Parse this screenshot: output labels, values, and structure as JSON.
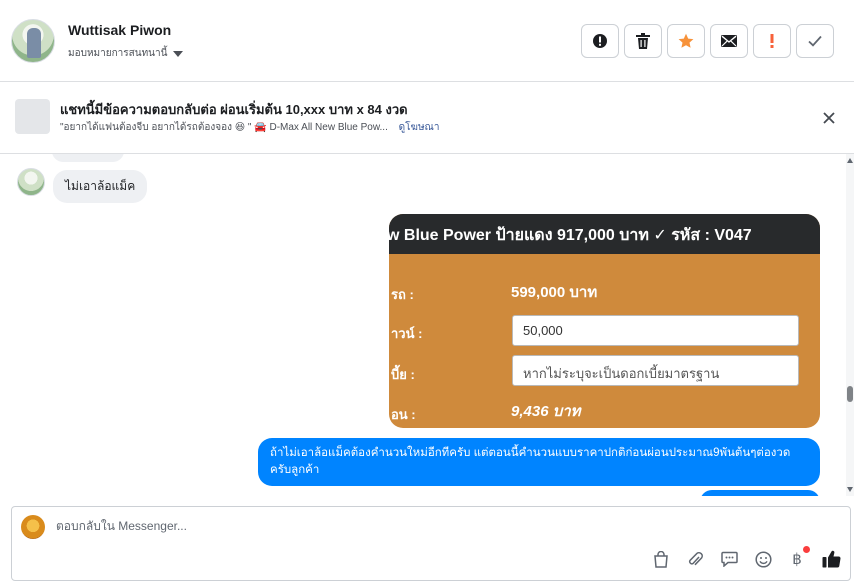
{
  "header": {
    "user_name": "Wuttisak Piwon",
    "assign_label": "มอบหมายการสนทนานี้",
    "actions": [
      {
        "name": "spam-button",
        "icon": "alert-circle-icon"
      },
      {
        "name": "delete-button",
        "icon": "trash-icon"
      },
      {
        "name": "star-button",
        "icon": "star-icon"
      },
      {
        "name": "mark-unread-button",
        "icon": "envelope-icon"
      },
      {
        "name": "follow-up-button",
        "icon": "exclamation-icon"
      },
      {
        "name": "mark-done-button",
        "icon": "checkmark-icon"
      }
    ]
  },
  "ad": {
    "title": "แชทนี้มีข้อความตอบกลับต่อ ผ่อนเริ่มต้น 10,xxx บาท x 84 งวด",
    "subtitle": "\"อยากได้แฟนต้องจีบ อยากได้รถต้องจอง 😆 \" 🚘 D-Max All New Blue Pow...",
    "link": "ดูโฆษณา"
  },
  "messages": {
    "incoming_1": "ไม่เอาล้อแม็ค",
    "image": {
      "title": "w Blue Power ป้ายแดง 917,000 บาท ✓ รหัส : V047",
      "rows": [
        {
          "label": "รถ :",
          "value": "599,000 บาท"
        },
        {
          "label": "าวน์ :",
          "value": "50,000"
        },
        {
          "label": "บี้ย :",
          "value": "หากไม่ระบุจะเป็นดอกเบี้ยมาตรฐาน"
        },
        {
          "label": "อน :",
          "value": "9,436 บาท"
        }
      ]
    },
    "outgoing_1": "ถ้าไม่เอาล้อแม็คต้องคำนวนใหม่อีกทีครับ แต่ตอนนี้คำนวนแบบราคาปกติก่อนผ่อนประมาณ9พันต้นๆต่องวด ครับลูกค้า"
  },
  "composer": {
    "placeholder": "ตอบกลับใน Messenger...",
    "tools": [
      "shop-bag-icon",
      "paperclip-icon",
      "saved-reply-icon",
      "emoji-icon",
      "baht-payment-icon",
      "thumbs-up-icon"
    ],
    "baht_symbol": "฿"
  },
  "colors": {
    "accent": "#0084ff",
    "star": "#f7923a",
    "follow_up": "#f7613a",
    "image_bg": "#cf8a3c",
    "image_header": "#282a2c"
  }
}
